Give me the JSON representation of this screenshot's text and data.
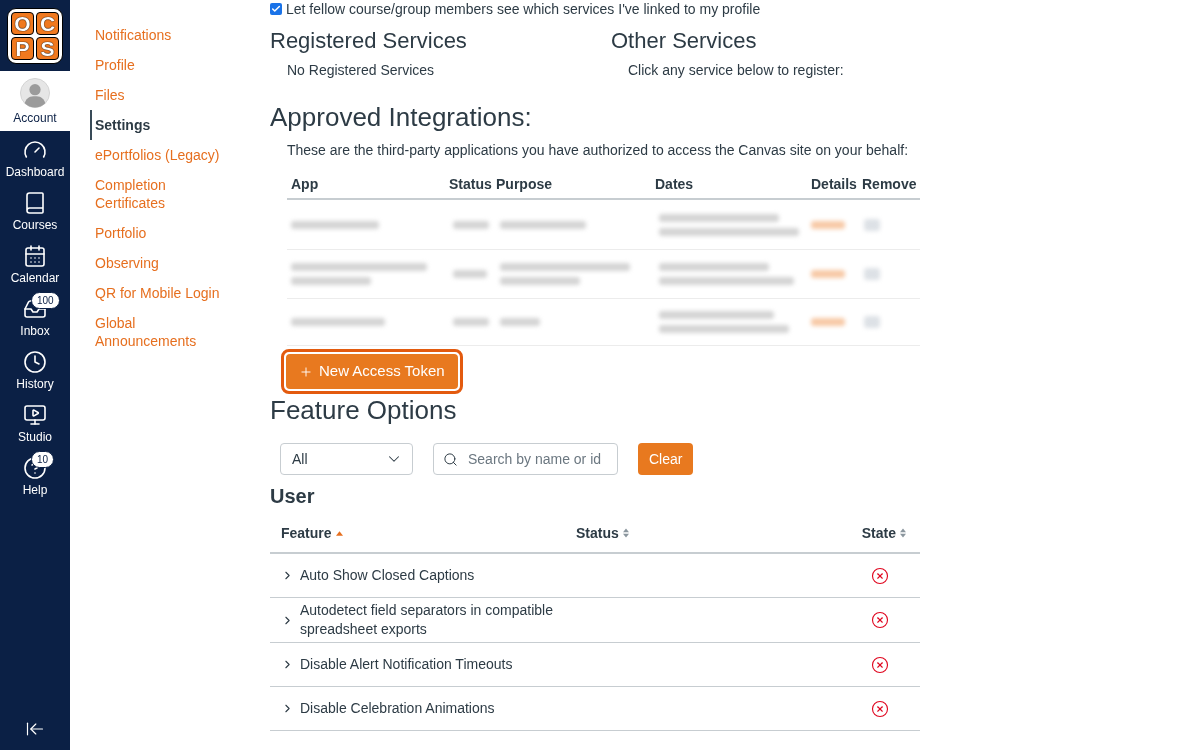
{
  "global_nav": {
    "logo": {
      "letters": [
        "O",
        "C",
        "P",
        "S"
      ]
    },
    "items": [
      {
        "kind": "account",
        "label": "Account",
        "selected": true
      },
      {
        "kind": "dashboard",
        "label": "Dashboard",
        "selected": false
      },
      {
        "kind": "courses",
        "label": "Courses",
        "selected": false
      },
      {
        "kind": "calendar",
        "label": "Calendar",
        "selected": false
      },
      {
        "kind": "inbox",
        "label": "Inbox",
        "selected": false,
        "badge": "100"
      },
      {
        "kind": "history",
        "label": "History",
        "selected": false
      },
      {
        "kind": "studio",
        "label": "Studio",
        "selected": false
      },
      {
        "kind": "help",
        "label": "Help",
        "selected": false,
        "badge": "10"
      }
    ]
  },
  "settings_nav": {
    "items": [
      {
        "label": "Notifications",
        "selected": false
      },
      {
        "label": "Profile",
        "selected": false
      },
      {
        "label": "Files",
        "selected": false
      },
      {
        "label": "Settings",
        "selected": true
      },
      {
        "label": "ePortfolios (Legacy)",
        "selected": false
      },
      {
        "label": "Completion Certificates",
        "selected": false
      },
      {
        "label": "Portfolio",
        "selected": false
      },
      {
        "label": "Observing",
        "selected": false
      },
      {
        "label": "QR for Mobile Login",
        "selected": false
      },
      {
        "label": "Global Announcements",
        "selected": false
      }
    ]
  },
  "profile_option": {
    "label": "Let fellow course/group members see which services I've linked to my profile",
    "checked": true
  },
  "registered_services": {
    "title": "Registered Services",
    "message": "No Registered Services"
  },
  "other_services": {
    "title": "Other Services",
    "message": "Click any service below to register:"
  },
  "approved_integrations": {
    "title": "Approved Integrations:",
    "description": "These are the third-party applications you have authorized to access the Canvas site on your behalf:",
    "columns": [
      "App",
      "Status",
      "Purpose",
      "Dates",
      "Details",
      "Remove"
    ],
    "new_token_button": {
      "label": "New Access Token",
      "focused": true
    }
  },
  "feature_options": {
    "title": "Feature Options",
    "filter": {
      "value": "All"
    },
    "search": {
      "placeholder": "Search by name or id"
    },
    "clear_button": {
      "label": "Clear"
    },
    "section_title": "User",
    "columns": [
      {
        "label": "Feature",
        "sorted": true
      },
      {
        "label": "Status",
        "sorted": false
      },
      {
        "label": "State",
        "sorted": false
      }
    ],
    "rows": [
      {
        "name": "Auto Show Closed Captions",
        "expanded": false,
        "enabled": false
      },
      {
        "name": "Autodetect field separators in compatible spreadsheet exports",
        "expanded": false,
        "enabled": false
      },
      {
        "name": "Disable Alert Notification Timeouts",
        "expanded": false,
        "enabled": false
      },
      {
        "name": "Disable Celebration Animations",
        "expanded": false,
        "enabled": false
      }
    ]
  }
}
